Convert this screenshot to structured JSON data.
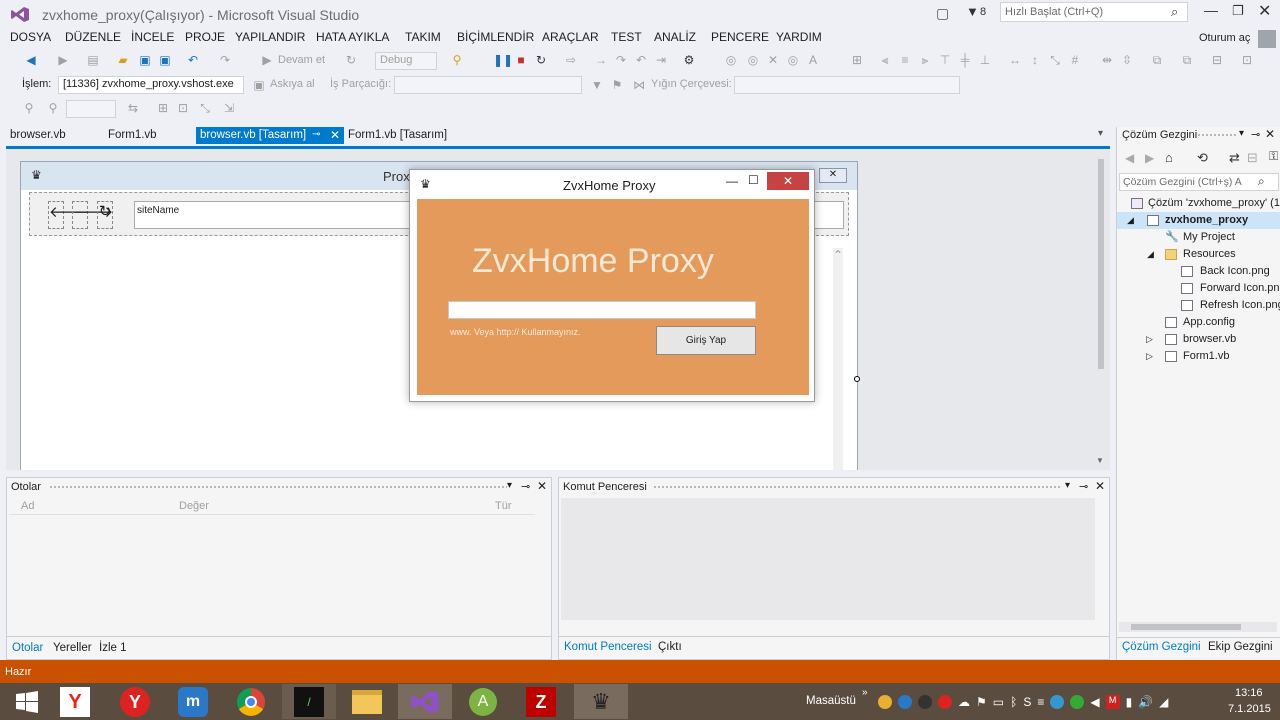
{
  "window": {
    "title": "zvxhome_proxy(Çalışıyor) - Microsoft Visual Studio",
    "notification_count": "8",
    "quick_launch_placeholder": "Hızlı Başlat (Ctrl+Q)",
    "signin": "Oturum aç"
  },
  "menu": [
    "DOSYA",
    "DÜZENLE",
    "İNCELE",
    "PROJE",
    "YAPILANDIR",
    "HATA AYIKLA",
    "TAKIM",
    "BİÇİMLENDİR",
    "ARAÇLAR",
    "TEST",
    "ANALİZ",
    "PENCERE",
    "YARDIM"
  ],
  "toolbar": {
    "continue_label": "Devam et",
    "config_value": "Debug",
    "process_label": "İşlem:",
    "process_value": "[11336] zvxhome_proxy.vshost.exe",
    "suspend_label": "Askıya al",
    "thread_label": "İş Parçacığı:",
    "stack_frame_label": "Yığın Çerçevesi:"
  },
  "doc_tabs": [
    "browser.vb",
    "Form1.vb",
    "browser.vb [Tasarım]",
    "Form1.vb [Tasarım]"
  ],
  "designer": {
    "back_form_title": "Prox",
    "site_textbox": "siteName"
  },
  "app": {
    "title": "ZvxHome Proxy",
    "heading": "ZvxHome Proxy",
    "hint": "www. Veya http:// Kullanmayınız.",
    "login_button": "Giriş Yap",
    "input_value": ""
  },
  "solution": {
    "title": "Çözüm Gezgini",
    "search_placeholder": "Çözüm Gezgini (Ctrl+ş) A",
    "items": [
      {
        "label": "Çözüm 'zvxhome_proxy' (1",
        "indent": 0
      },
      {
        "label": "zvxhome_proxy",
        "indent": 1,
        "bold": true
      },
      {
        "label": "My Project",
        "indent": 2
      },
      {
        "label": "Resources",
        "indent": 2
      },
      {
        "label": "Back Icon.png",
        "indent": 3
      },
      {
        "label": "Forward Icon.png",
        "indent": 3
      },
      {
        "label": "Refresh Icon.png",
        "indent": 3
      },
      {
        "label": "App.config",
        "indent": 2
      },
      {
        "label": "browser.vb",
        "indent": 2
      },
      {
        "label": "Form1.vb",
        "indent": 2
      }
    ],
    "tabs": [
      "Çözüm Gezgini",
      "Ekip Gezgini"
    ]
  },
  "autos": {
    "title": "Otolar",
    "columns": [
      "Ad",
      "Değer",
      "Tür"
    ],
    "tabs": [
      "Otolar",
      "Yereller",
      "İzle 1"
    ]
  },
  "command": {
    "title": "Komut Penceresi",
    "tabs": [
      "Komut Penceresi",
      "Çıktı"
    ]
  },
  "status": "Hazır",
  "taskbar": {
    "desktop_label": "Masaüstü",
    "time": "13:16",
    "date": "7.1.2015"
  },
  "colors": {
    "accent": "#007acc",
    "status": "#ca5100",
    "app_bg": "#e49a5a",
    "taskbar": "#5b4c40"
  }
}
